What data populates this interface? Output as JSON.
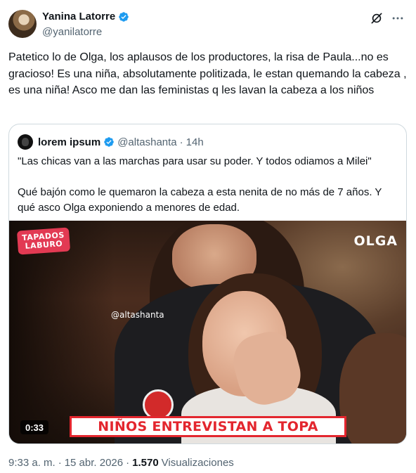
{
  "author": {
    "display_name": "Yanina Latorre",
    "handle": "@yanilatorre"
  },
  "tweet": {
    "text": "Patetico lo de Olga, los aplausos de los productores, la risa de Paula...no es gracioso! Es una niña, absolutamente politizada, le estan quemando la cabeza , es una niña! Asco me dan las feministas q les lavan la cabeza a los niños"
  },
  "quote": {
    "display_name": "lorem ipsum",
    "handle": "@altashanta",
    "separator": "·",
    "time": "14h",
    "text": "\"Las chicas van a las marchas para usar su poder. Y todos odiamos a Milei\"\n\nQué bajón como le quemaron la cabeza a esta nenita de no más de 7 años. Y qué asco Olga exponiendo a menores de edad.",
    "video": {
      "logo_line1": "TAPADOS",
      "logo_line2": "LABURO",
      "channel": "OLGA",
      "watermark": "@altashanta",
      "caption": "NIÑOS ENTREVISTAN A TOPA",
      "duration": "0:33"
    }
  },
  "meta": {
    "time": "9:33 a. m.",
    "date": "15 abr. 2026",
    "separator1": "·",
    "separator2": "·",
    "views_count": "1.570",
    "views_label": "Visualizaciones"
  },
  "colors": {
    "verified": "#1d9bf0",
    "text": "#0f1419",
    "secondary": "#536471",
    "caption_red": "#e3262e"
  },
  "icons": {
    "grok": "grok-icon",
    "more": "more-options-icon",
    "verified": "verified-badge-icon"
  }
}
